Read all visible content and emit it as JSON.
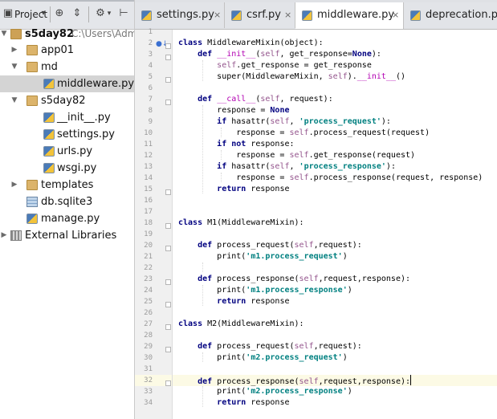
{
  "toolbar": {
    "project_label": "Project",
    "dropdown_glyph": "▾",
    "sync_glyph": "⊕",
    "collapse_glyph": "⇕",
    "settings_glyph": "⚙",
    "hide_glyph": "⊢"
  },
  "tree": {
    "root": {
      "name": "s5day82",
      "path": "C:\\Users\\Adm"
    },
    "items": [
      {
        "label": "app01"
      },
      {
        "label": "md"
      },
      {
        "label": "middleware.py"
      },
      {
        "label": "s5day82"
      },
      {
        "label": "__init__.py"
      },
      {
        "label": "settings.py"
      },
      {
        "label": "urls.py"
      },
      {
        "label": "wsgi.py"
      },
      {
        "label": "templates"
      },
      {
        "label": "db.sqlite3"
      },
      {
        "label": "manage.py"
      },
      {
        "label": "External Libraries"
      }
    ]
  },
  "tabs": [
    {
      "label": "settings.py",
      "close": "×"
    },
    {
      "label": "csrf.py",
      "close": "×"
    },
    {
      "label": "middleware.py",
      "close": "×"
    },
    {
      "label": "deprecation.py",
      "close": ""
    }
  ],
  "colors": {
    "keyword": "#000080",
    "self": "#94558d",
    "string": "#008080",
    "magic": "#b200b2",
    "current_line": "#fcfae5",
    "selected_file": "#d4d4d4"
  },
  "gutter": {
    "line_numbers": [
      "1",
      "2",
      "3",
      "4",
      "5",
      "6",
      "7",
      "8",
      "9",
      "10",
      "11",
      "12",
      "13",
      "14",
      "15",
      "16",
      "17",
      "18",
      "19",
      "20",
      "21",
      "22",
      "23",
      "24",
      "25",
      "26",
      "27",
      "28",
      "29",
      "30",
      "31",
      "32",
      "33",
      "34"
    ],
    "override_marker": "●↓"
  },
  "code": {
    "l2": {
      "kw": "class",
      "rest": " MiddlewareMixin(object):"
    },
    "l3": {
      "kw": "def",
      "magic": "__init__",
      "p1": "(",
      "self": "self",
      "rest": ", get_response=",
      "kw2": "None",
      "end": "):"
    },
    "l4": {
      "self": "self",
      "rest": ".get_response = get_response"
    },
    "l5": {
      "pre": "super(MiddlewareMixin, ",
      "self": "self",
      "mid": ").",
      "magic": "__init__",
      "end": "()"
    },
    "l7": {
      "kw": "def",
      "magic": "__call__",
      "p1": "(",
      "self": "self",
      "rest": ", request):"
    },
    "l8": {
      "pre": "response = ",
      "kw": "None"
    },
    "l9": {
      "kw": "if",
      "pre": " hasattr(",
      "self": "self",
      "sep": ", ",
      "str": "'process_request'",
      "end": "):"
    },
    "l10": {
      "pre": "response = ",
      "self": "self",
      "rest": ".process_request(request)"
    },
    "l11": {
      "kw": "if not",
      "rest": " response:"
    },
    "l12": {
      "pre": "response = ",
      "self": "self",
      "rest": ".get_response(request)"
    },
    "l13": {
      "kw": "if",
      "pre": " hasattr(",
      "self": "self",
      "sep": ", ",
      "str": "'process_response'",
      "end": "):"
    },
    "l14": {
      "pre": "response = ",
      "self": "self",
      "rest": ".process_response(request, response)"
    },
    "l15": {
      "kw": "return",
      "rest": " response"
    },
    "l18": {
      "kw": "class",
      "rest": " M1(MiddlewareMixin):"
    },
    "l20": {
      "kw": "def",
      "rest": " process_request(",
      "self": "self",
      "end": ",request):"
    },
    "l21": {
      "pre": "print(",
      "str": "'m1.process_request'",
      "end": ")"
    },
    "l23": {
      "kw": "def",
      "rest": " process_response(",
      "self": "self",
      "end": ",request,response):"
    },
    "l24": {
      "pre": "print(",
      "str": "'m1.process_response'",
      "end": ")"
    },
    "l25": {
      "kw": "return",
      "rest": " response"
    },
    "l27": {
      "kw": "class",
      "rest": " M2(MiddlewareMixin):"
    },
    "l29": {
      "kw": "def",
      "rest": " process_request(",
      "self": "self",
      "end": ",request):"
    },
    "l30": {
      "pre": "print(",
      "str": "'m2.process_request'",
      "end": ")"
    },
    "l32": {
      "kw": "def",
      "rest": " process_response(",
      "self": "self",
      "end": ",request,response):"
    },
    "l33": {
      "pre": "print(",
      "str": "'m2.process_response'",
      "end": ")"
    },
    "l34": {
      "kw": "return",
      "rest": " response"
    }
  }
}
